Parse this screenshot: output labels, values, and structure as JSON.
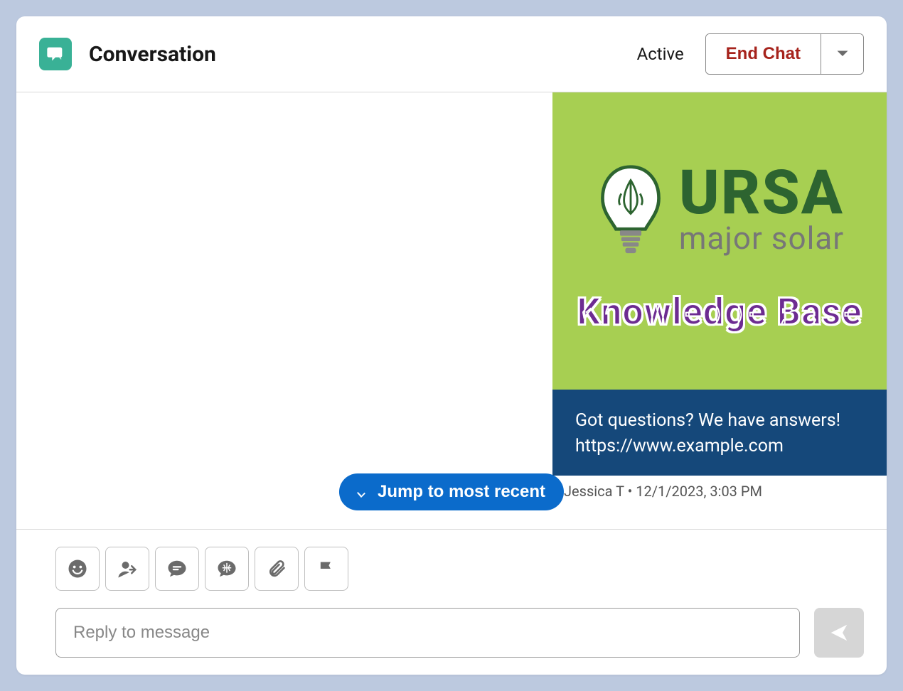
{
  "header": {
    "title": "Conversation",
    "status": "Active",
    "end_chat_label": "End Chat"
  },
  "message": {
    "brand_top": "URSA",
    "brand_sub": "major solar",
    "kb_label": "Knowledge Base",
    "caption_line1": "Got questions? We have answers!",
    "caption_line2": "https://www.example.com",
    "meta": "Jessica T • 12/1/2023, 3:03 PM"
  },
  "jump_label": "Jump to most recent",
  "toolbar": {
    "emoji": "emoji",
    "transfer": "transfer",
    "quick_text": "quick-text",
    "macro": "macro",
    "attach": "attach",
    "flag": "flag"
  },
  "input": {
    "placeholder": "Reply to message"
  }
}
